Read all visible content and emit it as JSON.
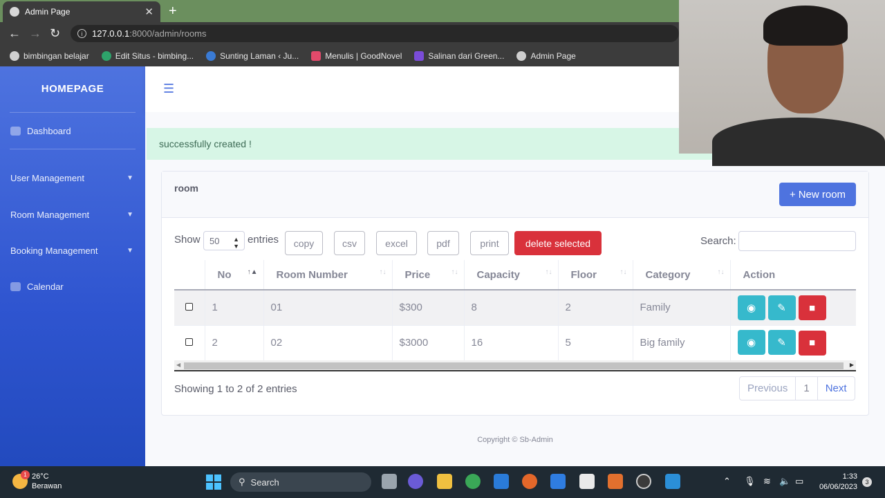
{
  "browser": {
    "tab_title": "Admin Page",
    "url_host": "127.0.0.1",
    "url_path": ":8000/admin/rooms",
    "bookmarks": [
      "bimbingan belajar",
      "Edit Situs - bimbing...",
      "Sunting Laman ‹ Ju...",
      "Menulis | GoodNovel",
      "Salinan dari Green...",
      "Admin Page"
    ]
  },
  "sidebar": {
    "brand": "HOMEPAGE",
    "items": [
      {
        "label": "Dashboard"
      },
      {
        "label": "User Management"
      },
      {
        "label": "Room Management"
      },
      {
        "label": "Booking Management"
      },
      {
        "label": "Calendar"
      }
    ]
  },
  "alert": {
    "message": "successfully created !"
  },
  "card": {
    "title": "room",
    "new_button": "New room",
    "show_label": "Show",
    "entries_value": "50",
    "entries_label": "entries",
    "buttons": [
      "copy",
      "csv",
      "excel",
      "pdf",
      "print",
      "delete selected"
    ],
    "search_label": "Search:",
    "search_value": ""
  },
  "table": {
    "columns": [
      "No",
      "Room Number",
      "Price",
      "Capacity",
      "Floor",
      "Category",
      "Action"
    ],
    "rows": [
      {
        "no": "1",
        "room_number": "01",
        "price": "$300",
        "capacity": "8",
        "floor": "2",
        "category": "Family"
      },
      {
        "no": "2",
        "room_number": "02",
        "price": "$3000",
        "capacity": "16",
        "floor": "5",
        "category": "Big family"
      }
    ]
  },
  "footer_table": {
    "info": "Showing 1 to 2 of 2 entries",
    "prev": "Previous",
    "page": "1",
    "next": "Next"
  },
  "footer": {
    "copyright": "Copyright © Sb-Admin"
  },
  "taskbar": {
    "weather_temp": "26°C",
    "weather_desc": "Berawan",
    "weather_badge": "1",
    "search_placeholder": "Search",
    "time": "1:33",
    "date": "06/06/2023",
    "notif_count": "3"
  },
  "colors": {
    "primary": "#4e73df",
    "danger": "#d9313b",
    "info": "#36b9cc",
    "success_bg": "#d7f6e6"
  }
}
